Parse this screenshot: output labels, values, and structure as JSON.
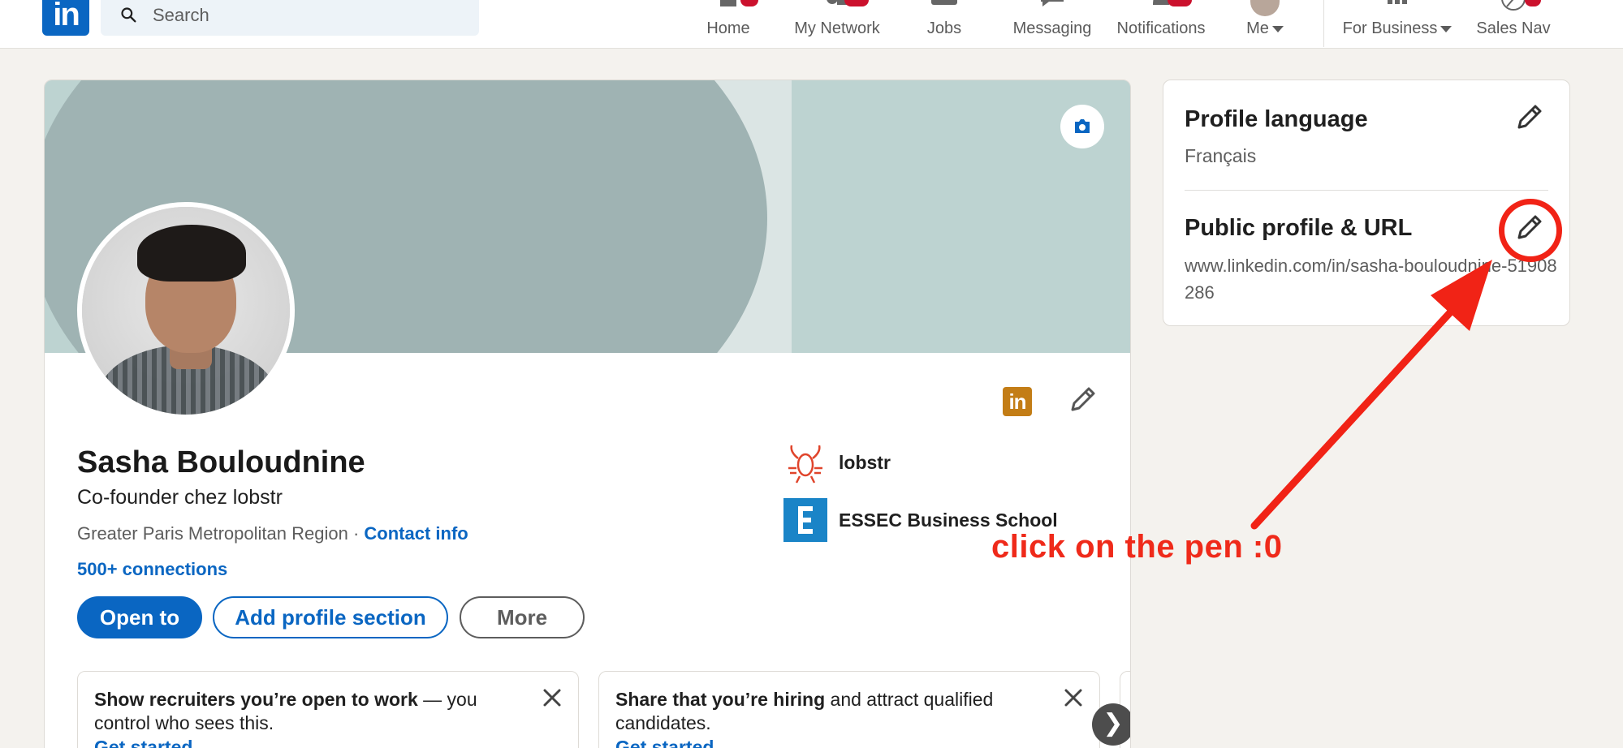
{
  "nav": {
    "search_placeholder": "Search",
    "items": [
      {
        "label": "Home",
        "icon": "home-icon"
      },
      {
        "label": "My Network",
        "icon": "network-icon"
      },
      {
        "label": "Jobs",
        "icon": "jobs-icon"
      },
      {
        "label": "Messaging",
        "icon": "messaging-icon"
      },
      {
        "label": "Notifications",
        "icon": "bell-icon"
      },
      {
        "label": "Me",
        "icon": "avatar"
      },
      {
        "label": "For Business",
        "icon": "grid-icon"
      },
      {
        "label": "Sales Nav",
        "icon": "compass-icon"
      }
    ],
    "logo_text": "in",
    "brand_color": "#0a66c2",
    "badge_color": "#cb112d"
  },
  "profile": {
    "name": "Sasha Bouloudnine",
    "headline": "Co-founder chez lobstr",
    "location": "Greater Paris Metropolitan Region",
    "location_separator": " · ",
    "contact_info": "Contact info",
    "connections": "500+ connections",
    "buttons": {
      "open_to": "Open to",
      "add_section": "Add profile section",
      "more": "More"
    },
    "organizations": [
      {
        "name": "lobstr",
        "icon": "lobster-icon"
      },
      {
        "name": "ESSEC Business School",
        "icon": "essec-logo"
      }
    ],
    "badge_text": "in"
  },
  "promos": [
    {
      "bold": "Show recruiters you’re open to work",
      "rest": " — you control who sees this.",
      "link": "Get started"
    },
    {
      "bold": "Share that you’re hiring",
      "rest": " and attract qualified candidates.",
      "link": "Get started"
    }
  ],
  "next_arrow": "❯",
  "sidebar": {
    "profile_language_title": "Profile language",
    "profile_language_value": "Français",
    "public_profile_title": "Public profile & URL",
    "public_profile_url": "www.linkedin.com/in/sasha-bouloudnine-51908286"
  },
  "annotation": {
    "text": "click on the pen :0",
    "color": "#f12316"
  }
}
